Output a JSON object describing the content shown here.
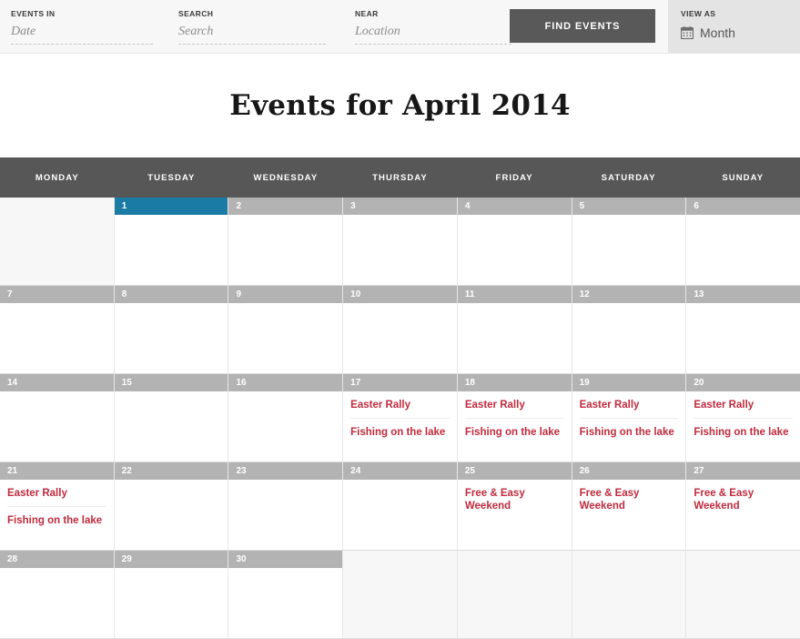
{
  "topbar": {
    "fields": [
      {
        "label": "EVENTS IN",
        "placeholder": "Date",
        "value": ""
      },
      {
        "label": "SEARCH",
        "placeholder": "Search",
        "value": ""
      },
      {
        "label": "NEAR",
        "placeholder": "Location",
        "value": ""
      }
    ],
    "find_button": "FIND EVENTS",
    "view_as": {
      "label": "VIEW AS",
      "icon": "calendar-icon",
      "value": "Month"
    }
  },
  "page_title": "Events for April 2014",
  "calendar": {
    "weekday_headers": [
      "MONDAY",
      "TUESDAY",
      "WEDNESDAY",
      "THURSDAY",
      "FRIDAY",
      "SATURDAY",
      "SUNDAY"
    ],
    "today": 1,
    "colors": {
      "header_bar": "#575757",
      "day_bar": "#b3b3b3",
      "today_bar": "#1a7ba4",
      "event_link": "#bf2b3e",
      "blank_cell": "#f7f7f7",
      "button": "#595959",
      "viewas_panel": "#e4e4e4"
    },
    "weeks": [
      [
        {
          "day": "",
          "blank": true,
          "events": []
        },
        {
          "day": "1",
          "today": true,
          "events": []
        },
        {
          "day": "2",
          "events": []
        },
        {
          "day": "3",
          "events": []
        },
        {
          "day": "4",
          "events": []
        },
        {
          "day": "5",
          "events": []
        },
        {
          "day": "6",
          "events": []
        }
      ],
      [
        {
          "day": "7",
          "events": []
        },
        {
          "day": "8",
          "events": []
        },
        {
          "day": "9",
          "events": []
        },
        {
          "day": "10",
          "events": []
        },
        {
          "day": "11",
          "events": []
        },
        {
          "day": "12",
          "events": []
        },
        {
          "day": "13",
          "events": []
        }
      ],
      [
        {
          "day": "14",
          "events": []
        },
        {
          "day": "15",
          "events": []
        },
        {
          "day": "16",
          "events": []
        },
        {
          "day": "17",
          "events": [
            "Easter Rally",
            "Fishing on the lake"
          ]
        },
        {
          "day": "18",
          "events": [
            "Easter Rally",
            "Fishing on the lake"
          ]
        },
        {
          "day": "19",
          "events": [
            "Easter Rally",
            "Fishing on the lake"
          ]
        },
        {
          "day": "20",
          "events": [
            "Easter Rally",
            "Fishing on the lake"
          ]
        }
      ],
      [
        {
          "day": "21",
          "events": [
            "Easter Rally",
            "Fishing on the lake"
          ]
        },
        {
          "day": "22",
          "events": []
        },
        {
          "day": "23",
          "events": []
        },
        {
          "day": "24",
          "events": []
        },
        {
          "day": "25",
          "events": [
            "Free & Easy Weekend"
          ]
        },
        {
          "day": "26",
          "events": [
            "Free & Easy Weekend"
          ]
        },
        {
          "day": "27",
          "events": [
            "Free & Easy Weekend"
          ]
        }
      ],
      [
        {
          "day": "28",
          "events": []
        },
        {
          "day": "29",
          "events": []
        },
        {
          "day": "30",
          "events": []
        },
        {
          "day": "",
          "blank": true,
          "events": []
        },
        {
          "day": "",
          "blank": true,
          "events": []
        },
        {
          "day": "",
          "blank": true,
          "events": []
        },
        {
          "day": "",
          "blank": true,
          "events": []
        }
      ]
    ]
  }
}
